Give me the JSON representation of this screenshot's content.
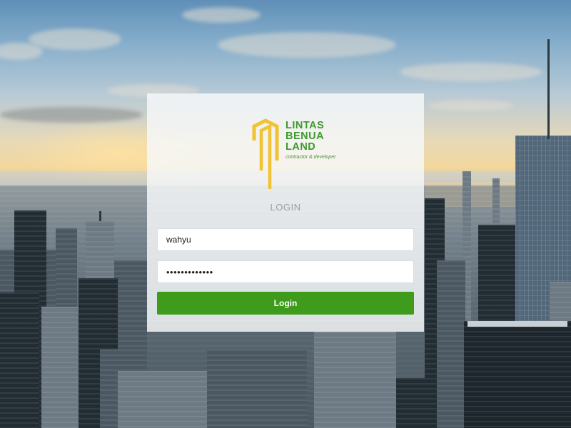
{
  "brand": {
    "name_lines": [
      "LINTAS",
      "BENUA",
      "LAND"
    ],
    "tagline": "contractor & developer",
    "colors": {
      "green": "#3e9a2d",
      "yellow": "#f1c232"
    }
  },
  "login": {
    "title": "LOGIN",
    "username_value": "wahyu",
    "password_value": "•••••••••••••",
    "button_label": "Login",
    "button_color": "#3f9b1c"
  },
  "background": {
    "description_icon": "city-skyline-background"
  }
}
